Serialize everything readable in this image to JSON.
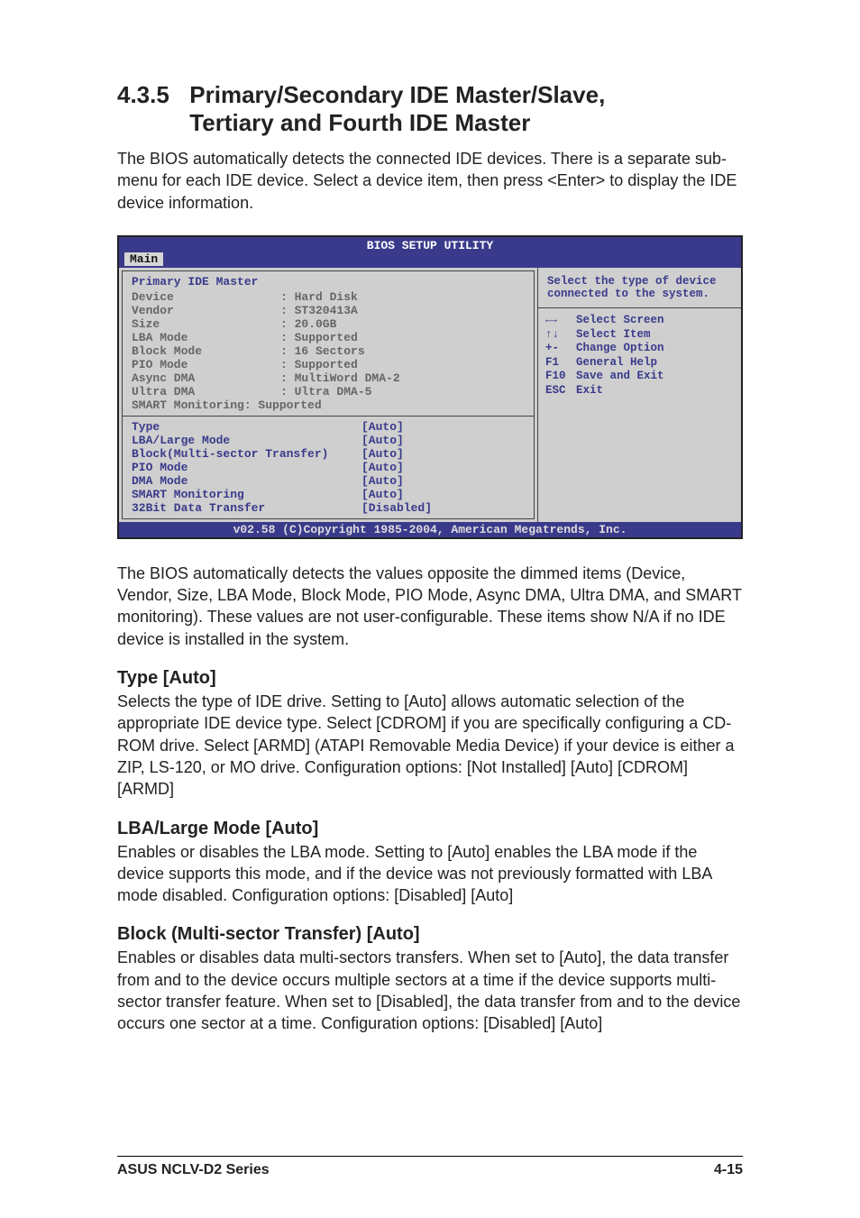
{
  "section": {
    "number": "4.3.5",
    "title_line1": "Primary/Secondary IDE Master/Slave,",
    "title_line2": "Tertiary and Fourth IDE Master"
  },
  "intro": "The BIOS automatically detects the connected IDE devices. There is a separate sub-menu for each IDE device. Select a device item, then press <Enter> to display the IDE device information.",
  "bios": {
    "title": "BIOS SETUP UTILITY",
    "tab": "Main",
    "panel_header": "Primary IDE Master",
    "dimmed": [
      {
        "label": "Device",
        "value": ": Hard Disk"
      },
      {
        "label": "Vendor",
        "value": ": ST320413A"
      },
      {
        "label": "Size",
        "value": ": 20.0GB"
      },
      {
        "label": "LBA Mode",
        "value": ": Supported"
      },
      {
        "label": "Block Mode",
        "value": ": 16 Sectors"
      },
      {
        "label": "PIO Mode",
        "value": ": Supported"
      },
      {
        "label": "Async DMA",
        "value": ": MultiWord DMA-2"
      },
      {
        "label": "Ultra DMA",
        "value": ": Ultra DMA-5"
      },
      {
        "label": "SMART Monitoring: Supported",
        "value": ""
      }
    ],
    "settings": [
      {
        "label": "Type",
        "value": "[Auto]"
      },
      {
        "label": "LBA/Large Mode",
        "value": "[Auto]"
      },
      {
        "label": "Block(Multi-sector Transfer)",
        "value": "[Auto]"
      },
      {
        "label": "PIO Mode",
        "value": "[Auto]"
      },
      {
        "label": "DMA Mode",
        "value": "[Auto]"
      },
      {
        "label": "SMART Monitoring",
        "value": "[Auto]"
      },
      {
        "label": "32Bit Data Transfer",
        "value": "[Disabled]"
      }
    ],
    "help_text": "Select the type of device connected to the system.",
    "nav": [
      {
        "key": "←→",
        "label": "Select Screen"
      },
      {
        "key": "↑↓",
        "label": "Select Item"
      },
      {
        "key": "+-",
        "label": "Change Option"
      },
      {
        "key": "F1",
        "label": "General Help"
      },
      {
        "key": "F10",
        "label": "Save and Exit"
      },
      {
        "key": "ESC",
        "label": "Exit"
      }
    ],
    "footer": "v02.58 (C)Copyright 1985-2004, American Megatrends, Inc."
  },
  "after_bios": "The BIOS automatically detects the values opposite the dimmed items (Device, Vendor, Size, LBA Mode, Block Mode, PIO Mode, Async DMA, Ultra DMA, and SMART monitoring). These values are not user-configurable. These items show N/A if no IDE device is installed in the system.",
  "type_section": {
    "heading": "Type [Auto]",
    "body": "Selects the type of IDE drive. Setting to [Auto] allows automatic selection of the appropriate IDE device type. Select [CDROM] if you are specifically configuring a CD-ROM drive. Select [ARMD] (ATAPI Removable Media Device) if your device is either a ZIP, LS-120, or MO drive. Configuration options: [Not Installed] [Auto] [CDROM] [ARMD]"
  },
  "lba_section": {
    "heading": "LBA/Large Mode [Auto]",
    "body": "Enables or disables the LBA mode. Setting to [Auto] enables the LBA mode if the device supports this mode, and if the device was not previously formatted with LBA mode disabled. Configuration options: [Disabled] [Auto]"
  },
  "block_section": {
    "heading": "Block (Multi-sector Transfer) [Auto]",
    "body": "Enables or disables data multi-sectors transfers. When set to [Auto], the data transfer from and to the device occurs multiple sectors at a time if the device supports multi-sector transfer feature. When set to [Disabled], the data transfer from and to the device occurs one sector at a time. Configuration options: [Disabled] [Auto]"
  },
  "footer_left": "ASUS NCLV-D2 Series",
  "footer_right": "4-15"
}
